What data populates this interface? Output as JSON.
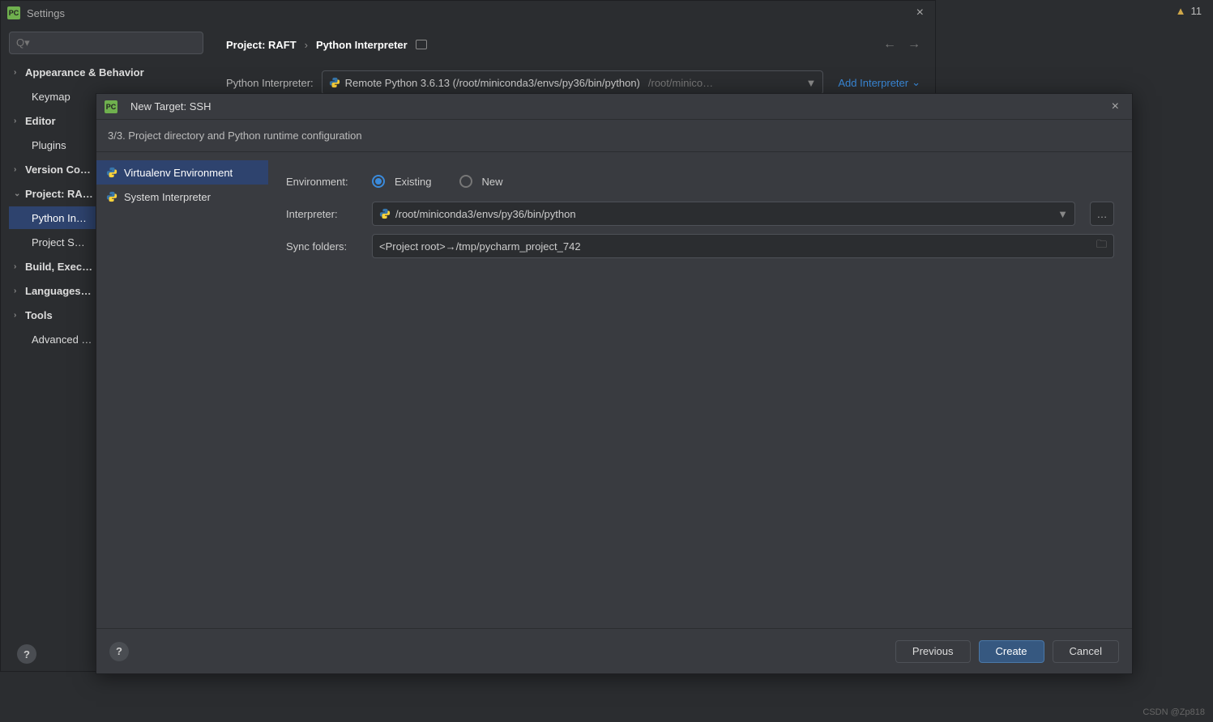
{
  "ide": {
    "warnings": "11"
  },
  "settings": {
    "title": "Settings",
    "search_placeholder": "Q▾",
    "tree": {
      "appearance": "Appearance & Behavior",
      "keymap": "Keymap",
      "editor": "Editor",
      "plugins": "Plugins",
      "version": "Version Co…",
      "project": "Project: RA…",
      "python_interp": "Python In…",
      "project_s": "Project S…",
      "build": "Build, Exec…",
      "languages": "Languages…",
      "tools": "Tools",
      "advanced": "Advanced …"
    },
    "breadcrumb": {
      "project": "Project: RAFT",
      "current": "Python Interpreter"
    },
    "interpreter": {
      "label": "Python Interpreter:",
      "value_main": "Remote Python 3.6.13 (/root/miniconda3/envs/py36/bin/python)",
      "value_dim": "/root/minico…",
      "add_label": "Add Interpreter"
    }
  },
  "ssh": {
    "title": "New Target: SSH",
    "step": "3/3. Project directory and Python runtime configuration",
    "env_options": {
      "virtualenv": "Virtualenv Environment",
      "system": "System Interpreter"
    },
    "form": {
      "environment_label": "Environment:",
      "existing": "Existing",
      "new": "New",
      "interpreter_label": "Interpreter:",
      "interpreter_value": "/root/miniconda3/envs/py36/bin/python",
      "sync_label": "Sync folders:",
      "sync_value": "<Project root>→/tmp/pycharm_project_742"
    },
    "buttons": {
      "previous": "Previous",
      "create": "Create",
      "cancel": "Cancel"
    }
  },
  "watermark": "CSDN @Zp818"
}
